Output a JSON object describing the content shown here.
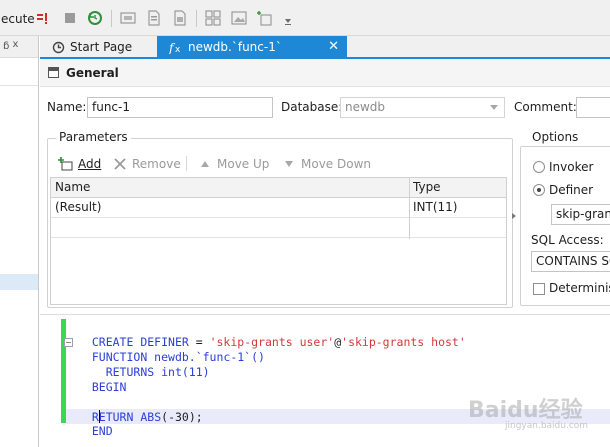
{
  "toolbar": {
    "execute_label": "ecute",
    "icons": [
      "execute-partial-icon",
      "stop-icon",
      "undo-icon",
      "sql-preview-icon",
      "export-icon",
      "import-icon",
      "grid-icon",
      "image-icon",
      "new-tab-icon",
      "chevron-down-icon"
    ]
  },
  "left_panel": {
    "pin_label": "ᵷ x"
  },
  "tabs": [
    {
      "label": "Start Page",
      "icon": "start-page-icon"
    },
    {
      "label": "newdb.`func-1`",
      "icon": "function-icon",
      "close": "✕"
    }
  ],
  "general": {
    "title": "General",
    "name_label": "Name:",
    "name_value": "func-1",
    "database_label": "Database:",
    "database_value": "newdb",
    "comment_label": "Comment:",
    "comment_value": ""
  },
  "parameters": {
    "title": "Parameters",
    "toolbar": {
      "add": "Add",
      "remove": "Remove",
      "move_up": "Move Up",
      "move_down": "Move Down"
    },
    "columns": [
      "Name",
      "Type"
    ],
    "rows": [
      {
        "name": "(Result)",
        "type": "INT(11)"
      },
      {
        "name": "",
        "type": ""
      }
    ]
  },
  "options": {
    "title": "Options",
    "invoker_label": "Invoker",
    "definer_label": "Definer",
    "definer_value": "skip-grant",
    "security_selected": "Definer",
    "sql_access_label": "SQL Access:",
    "sql_access_value": "CONTAINS SQ",
    "deterministic_label": "Determinist",
    "deterministic_checked": false
  },
  "code": {
    "line1": {
      "kw1": "CREATE DEFINER",
      "op": " = ",
      "s1": "'skip-grants user'",
      "at": "@",
      "s2": "'skip-grants host'"
    },
    "line2": {
      "kw": "FUNCTION",
      "rest": " newdb.`func-1`()"
    },
    "line3": {
      "kw": "  RETURNS",
      "rest": " int(11)"
    },
    "line4": {
      "kw": "BEGIN"
    },
    "line5": {
      "text": ""
    },
    "line6": {
      "kw": "RETURN",
      "sp": " ",
      "fn": "ABS",
      "open": "(",
      "num": "-30",
      "close": ");"
    },
    "line7": {
      "kw": "END"
    }
  },
  "watermark": {
    "main": "Baidu经验",
    "sub": "jingyan.baidu.com"
  },
  "colors": {
    "tab_active": "#1e88d6",
    "keyword": "#2b3fd6",
    "string": "#d23a3a",
    "gutter_change": "#3fd74a",
    "current_line": "#e9ebfa"
  }
}
